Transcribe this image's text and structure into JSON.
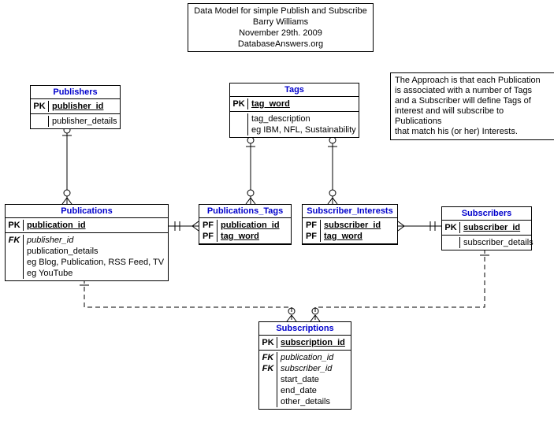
{
  "title": {
    "line1": "Data Model for simple Publish and Subscribe",
    "line2": "Barry Williams",
    "line3": "November 29th. 2009",
    "line4": "DatabaseAnswers.org"
  },
  "note": {
    "line1": "The Approach is that each Publication",
    "line2": "is associated with a number of Tags",
    "line3": "and a Subscriber will define Tags of",
    "line4": "interest and will subscribe to Publications",
    "line5": "that match his (or her) Interests."
  },
  "entities": {
    "publishers": {
      "name": "Publishers",
      "pk": "publisher_id",
      "attrs": [
        "publisher_details"
      ]
    },
    "tags": {
      "name": "Tags",
      "pk": "tag_word",
      "attrs": [
        "tag_description",
        "eg IBM, NFL, Sustainability"
      ]
    },
    "publications": {
      "name": "Publications",
      "pk": "publication_id",
      "fk": "publisher_id",
      "attrs": [
        "publication_details",
        "eg Blog, Publication, RSS Feed, TV",
        "eg YouTube"
      ]
    },
    "publications_tags": {
      "name": "Publications_Tags",
      "pf1": "publication_id",
      "pf2": "tag_word"
    },
    "subscriber_interests": {
      "name": "Subscriber_Interests",
      "pf1": "subscriber_id",
      "pf2": "tag_word"
    },
    "subscribers": {
      "name": "Subscribers",
      "pk": "subscriber_id",
      "attrs": [
        "subscriber_details"
      ]
    },
    "subscriptions": {
      "name": "Subscriptions",
      "pk": "subscription_id",
      "fk1": "publication_id",
      "fk2": "subscriber_id",
      "attrs": [
        "start_date",
        "end_date",
        "other_details"
      ]
    }
  },
  "keys": {
    "PK": "PK",
    "FK": "FK",
    "PF": "PF"
  }
}
